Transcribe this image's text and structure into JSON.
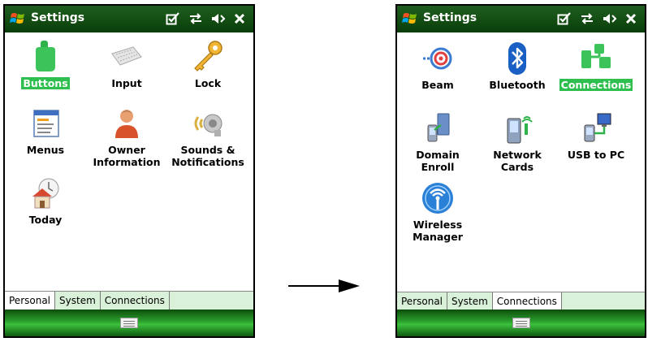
{
  "screenA": {
    "title": "Settings",
    "items": [
      {
        "label": "Buttons",
        "icon": "buttons-icon",
        "selected": true
      },
      {
        "label": "Input",
        "icon": "keyboard-icon",
        "selected": false
      },
      {
        "label": "Lock",
        "icon": "key-icon",
        "selected": false
      },
      {
        "label": "Menus",
        "icon": "menus-icon",
        "selected": false
      },
      {
        "label_line1": "Owner",
        "label_line2": "Information",
        "icon": "owner-icon",
        "selected": false
      },
      {
        "label_line1": "Sounds &",
        "label_line2": "Notifications",
        "icon": "sounds-icon",
        "selected": false
      },
      {
        "label": "Today",
        "icon": "today-icon",
        "selected": false
      }
    ],
    "tabs": [
      "Personal",
      "System",
      "Connections"
    ],
    "active_tab": "Personal"
  },
  "screenB": {
    "title": "Settings",
    "items": [
      {
        "label": "Beam",
        "icon": "beam-icon",
        "selected": false
      },
      {
        "label": "Bluetooth",
        "icon": "bluetooth-icon",
        "selected": false
      },
      {
        "label": "Connections",
        "icon": "connections-icon",
        "selected": true
      },
      {
        "label_line1": "Domain",
        "label_line2": "Enroll",
        "icon": "domain-enroll-icon",
        "selected": false
      },
      {
        "label_line1": "Network",
        "label_line2": "Cards",
        "icon": "network-cards-icon",
        "selected": false
      },
      {
        "label": "USB to PC",
        "icon": "usb-to-pc-icon",
        "selected": false
      },
      {
        "label_line1": "Wireless",
        "label_line2": "Manager",
        "icon": "wireless-manager-icon",
        "selected": false
      }
    ],
    "tabs": [
      "Personal",
      "System",
      "Connections"
    ],
    "active_tab": "Connections"
  },
  "colors": {
    "titlebar": "#0a3d0a",
    "selection": "#2fbf4f",
    "tab_bg": "#d9f0d9"
  }
}
